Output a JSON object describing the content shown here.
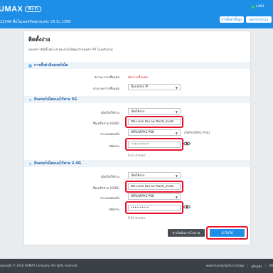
{
  "header": {
    "brand": "UMAX",
    "brand_badge": "Wi-Fi",
    "model": "2214A ชื่อโมเดลหรือหมายเลข: V5.5c.1399",
    "status": "LAN1",
    "btn_quick": "การตั้งค่าขั้นสูง",
    "btn_logout": "ออกจากระบบ"
  },
  "page": {
    "title": "ติดตั้งง่าย",
    "description": "ผลกดการติดตั้งอย่างง่ายจะช่วยให้คุณกำหนดค่า AP ในเครือข่าย"
  },
  "internet": {
    "section_title": "การตั้งค่าอินเทอร์เน็ต",
    "status_label": "สถานะการเชื่อมต่อ",
    "status_value": "ตัดการเชื่อมต่อ",
    "type_label": "ประเภทการเชื่อมต่อ",
    "type_value": "Dynamic IP"
  },
  "wifi5": {
    "section_title": "อินเทอร์เน็ตแบบไร้สาย 5G",
    "onoff_label": "เปิด/ปิดใช้งาน",
    "onoff_value": "เปิดใช้งาน",
    "ssid_label": "ชื่อเครือข่าย (SSID)",
    "ssid_value": "We Love You So Much_5GHz",
    "security_label": "ความปลอดภัย",
    "security_value": "WPA/WPA2-PSK",
    "security_note": "(WPA/WPA2-PSK)",
    "password_label": "รหัสผ่าน",
    "password_value": "••••••••••",
    "hint": "8-63 ตัวอักษร"
  },
  "wifi24": {
    "section_title": "อินเทอร์เน็ตแบบไร้สาย 2.4G",
    "onoff_label": "เปิด/ปิดใช้งาน",
    "onoff_value": "เปิดใช้งาน",
    "ssid_label": "ชื่อเครือข่าย (SSID)",
    "ssid_value": "We Love You So Much_2GHz",
    "security_label": "ความปลอดภัย",
    "security_value": "WPA/WPA2-PSK",
    "password_label": "รหัสผ่าน",
    "password_value": "••••••••••",
    "hint": "8-63 ตัวอักษร"
  },
  "actions": {
    "advanced": "ค่าเริ่มต้นการโรงงาน",
    "apply": "นำไปใช้"
  },
  "footer": {
    "copyright": "opyright © 2016 HUMAX Company. All rights reserved.",
    "site": "www.humaxdigital.com/gw",
    "manual": "คู่มือคู่มือ",
    "online": "ON"
  },
  "colors": {
    "header_blue": "#1f8ee6",
    "highlight_red": "#e8112d",
    "status_red": "#e03030"
  }
}
